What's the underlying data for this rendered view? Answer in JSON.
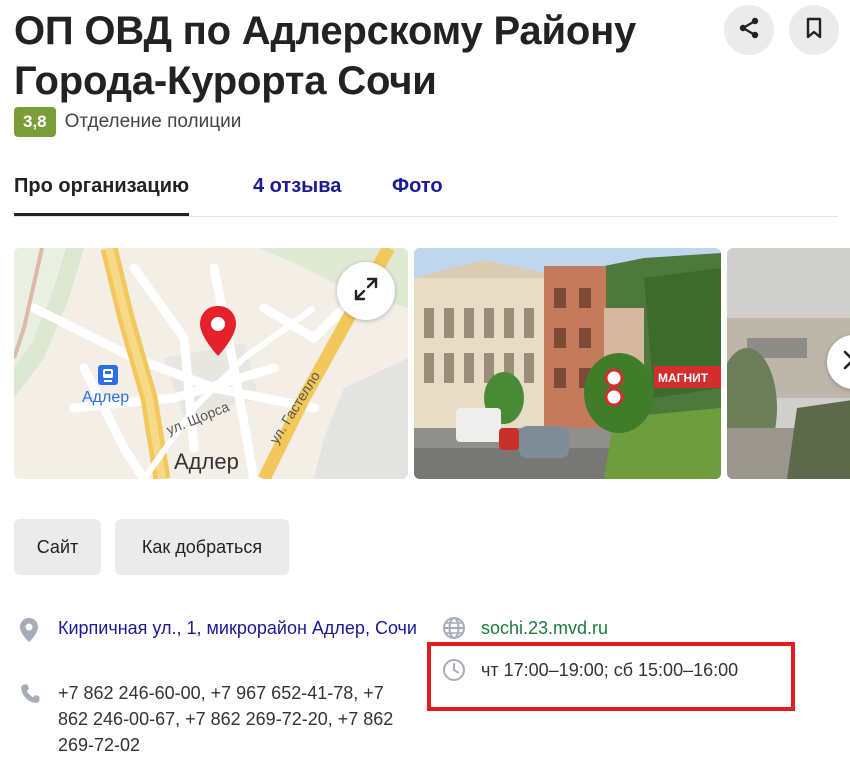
{
  "header": {
    "title": "ОП ОВД по Адлерскому Району Города-Курорта Сочи",
    "rating": "3,8",
    "category": "Отделение полиции"
  },
  "actions": {
    "share_icon": "share-icon",
    "bookmark_icon": "bookmark-icon"
  },
  "tabs": [
    {
      "label": "Про организацию",
      "active": true
    },
    {
      "label": "4 отзыва",
      "active": false
    },
    {
      "label": "Фото",
      "active": false
    }
  ],
  "map": {
    "label_station": "Адлер",
    "label_district": "Адлер",
    "street_1": "ул. Щорса",
    "street_2": "ул. Гастелло",
    "pin_color": "#e6212b",
    "road_color": "#f2c85b"
  },
  "photo": {
    "sign_text": "МАГНИТ"
  },
  "buttons": {
    "site": "Сайт",
    "route": "Как добраться"
  },
  "info": {
    "address": "Кирпичная ул., 1, микрорайон Адлер, Сочи",
    "phones": "+7 862 246-60-00, +7 967 652-41-78, +7 862 246-00-67, +7 862 269-72-20, +7 862 269-72-02",
    "website": "sochi.23.mvd.ru",
    "hours": "чт 17:00–19:00; сб 15:00–16:00"
  },
  "colors": {
    "rating_badge": "#7a9d3a",
    "link": "#1a1a99",
    "website_link": "#1d7a3b",
    "highlight": "#e11d23"
  }
}
